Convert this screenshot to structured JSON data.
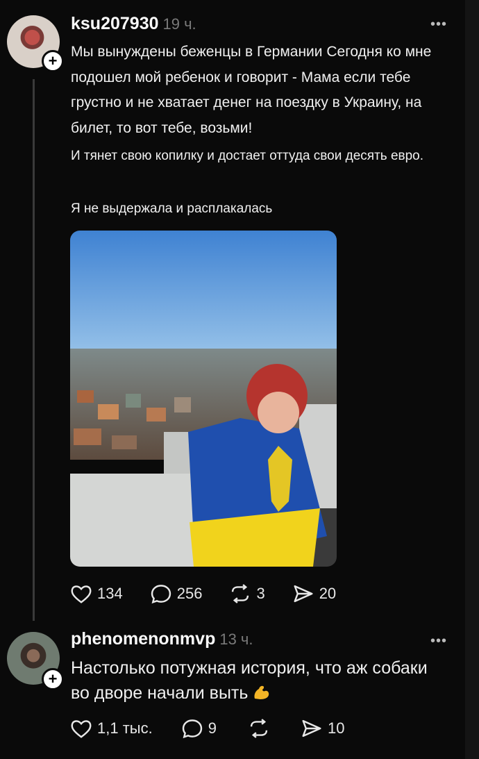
{
  "post1": {
    "username": "ksu207930",
    "time": "19 ч.",
    "more_label": "•••",
    "paragraph1": "Мы вынуждены беженцы в Германии Сегодня ко мне подошел мой ребенок и говорит - Мама если тебе грустно и не хватает денег на поездку в Украину, на билет, то вот тебе, возьми!",
    "paragraph2": "И тянет свою копилку и достает оттуда свои десять евро.",
    "paragraph3": "Я не выдержала и расплакалась",
    "stats": {
      "likes": "134",
      "comments": "256",
      "reposts": "3",
      "shares": "20"
    }
  },
  "post2": {
    "username": "phenomenonmvp",
    "time": "13 ч.",
    "more_label": "•••",
    "text": "Настолько потужная история, что аж собаки во дворе начали выть",
    "emoji": "flexed-biceps",
    "stats": {
      "likes": "1,1 тыс.",
      "comments": "9",
      "reposts": "",
      "shares": "10"
    }
  },
  "icons": [
    "heart-icon",
    "comment-icon",
    "repost-icon",
    "share-icon",
    "plus-icon",
    "more-icon"
  ],
  "colors": {
    "background": "#0a0a0a",
    "text": "#f2f2f2",
    "muted": "#7a7a7a",
    "flag_blue": "#1f4fae",
    "flag_yellow": "#f1d31c"
  }
}
